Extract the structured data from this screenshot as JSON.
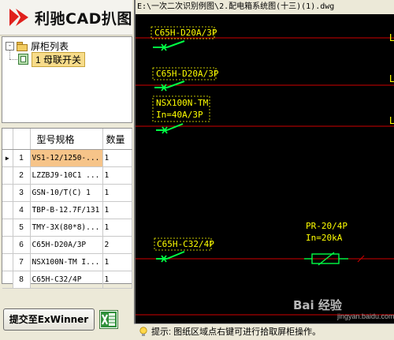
{
  "app": {
    "title": "利驰CAD扒图"
  },
  "tree": {
    "root_label": "屏柜列表",
    "root_expander": "-",
    "child_label": "1 母联开关"
  },
  "grid": {
    "columns": [
      "型号规格",
      "数量"
    ],
    "rows": [
      {
        "num": "1",
        "spec": "VS1-12/1250-...",
        "qty": "1",
        "selected": true
      },
      {
        "num": "2",
        "spec": "LZZBJ9-10C1 ...",
        "qty": "1"
      },
      {
        "num": "3",
        "spec": "GSN-10/T(C) 1",
        "qty": "1"
      },
      {
        "num": "4",
        "spec": "TBP-B-12.7F/131",
        "qty": "1"
      },
      {
        "num": "5",
        "spec": "TMY-3X(80*8)...",
        "qty": "1"
      },
      {
        "num": "6",
        "spec": "C65H-D20A/3P",
        "qty": "2"
      },
      {
        "num": "7",
        "spec": "NSX100N-TM I...",
        "qty": "1"
      },
      {
        "num": "8",
        "spec": "C65H-C32/4P",
        "qty": "1"
      }
    ],
    "current_row_marker": "▶"
  },
  "buttons": {
    "submit_label": "提交至ExWinner",
    "excel_icon": "excel-icon"
  },
  "cad": {
    "file_path": "E:\\一次二次识别例图\\2.配电箱系统图(十三)(1).dwg",
    "labels": {
      "breaker1": "C65H-D20A/3P",
      "breaker2": "C65H-D20A/3P",
      "breaker3_line1": "NSX100N-TM",
      "breaker3_line2": "In=40A/3P",
      "breaker4": "C65H-C32/4P",
      "pr_line1": "PR-20/4P",
      "pr_line2": "In=20kA",
      "edge_mark": "L"
    },
    "colors": {
      "background": "#000000",
      "line": "#d00000",
      "wire": "#00ff44",
      "text": "#ffff00"
    }
  },
  "status": {
    "text": "提示: 图纸区域点右键可进行拾取屏柜操作。"
  },
  "watermark": {
    "text": "Bai 经验",
    "sub": "jingyan.baidu.com"
  }
}
